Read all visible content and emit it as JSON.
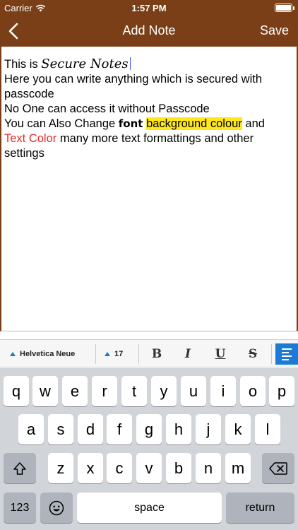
{
  "status_bar": {
    "carrier": "Carrier",
    "time": "1:57 PM"
  },
  "nav": {
    "title": "Add Note",
    "save_label": "Save"
  },
  "note": {
    "l1_prefix": "This is ",
    "l1_script": "Secure Notes",
    "l2": "Here you can write anything which is secured with passcode",
    "l3": "No One can access it without Passcode",
    "l4_a": "You can Also Change ",
    "l4_font": "font",
    "l4_sp": " ",
    "l4_highlight": "background colour",
    "l4_b": " and",
    "l5_red": "Text Color",
    "l5_rest": " many more  text formattings and other settings"
  },
  "toolbar": {
    "font_name": "Helvetica Neue",
    "font_size": "17",
    "bold": "B",
    "italic": "I",
    "underline": "U",
    "strike": "S"
  },
  "keyboard": {
    "row1": [
      "q",
      "w",
      "e",
      "r",
      "t",
      "y",
      "u",
      "i",
      "o",
      "p"
    ],
    "row2": [
      "a",
      "s",
      "d",
      "f",
      "g",
      "h",
      "j",
      "k",
      "l"
    ],
    "row3": [
      "z",
      "x",
      "c",
      "v",
      "b",
      "n",
      "m"
    ],
    "numbers_label": "123",
    "space_label": "space",
    "return_label": "return"
  }
}
